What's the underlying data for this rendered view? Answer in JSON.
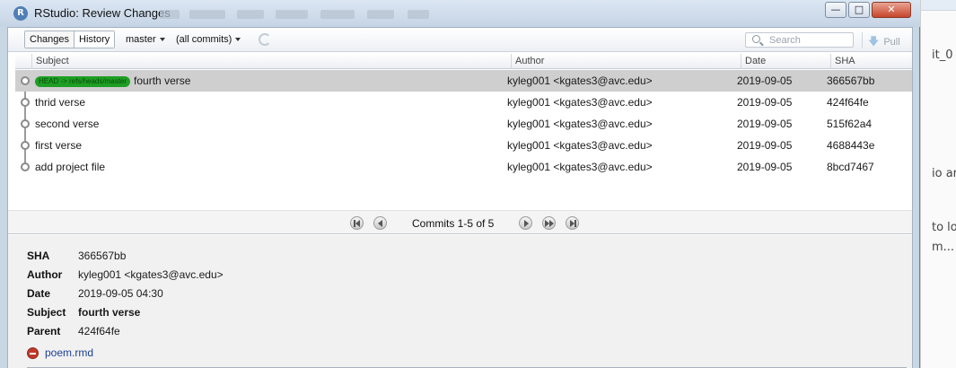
{
  "window": {
    "title": "RStudio: Review Changes",
    "app_icon_letter": "R"
  },
  "toolbar": {
    "tabs": [
      {
        "label": "Changes"
      },
      {
        "label": "History"
      }
    ],
    "branch": "master",
    "filter": "(all commits)",
    "search_placeholder": "Search",
    "pull_label": "Pull"
  },
  "table": {
    "columns": [
      "Subject",
      "Author",
      "Date",
      "SHA"
    ],
    "rows": [
      {
        "subject": "fourth  verse",
        "author": "kyleg001 <kgates3@avc.edu>",
        "date": "2019-09-05",
        "sha": "366567bb",
        "ref_label": "HEAD -> refs/heads/master",
        "selected": true
      },
      {
        "subject": "thrid verse",
        "author": "kyleg001 <kgates3@avc.edu>",
        "date": "2019-09-05",
        "sha": "424f64fe"
      },
      {
        "subject": "second verse",
        "author": "kyleg001 <kgates3@avc.edu>",
        "date": "2019-09-05",
        "sha": "515f62a4"
      },
      {
        "subject": "first verse",
        "author": "kyleg001 <kgates3@avc.edu>",
        "date": "2019-09-05",
        "sha": "4688443e"
      },
      {
        "subject": "add project file",
        "author": "kyleg001 <kgates3@avc.edu>",
        "date": "2019-09-05",
        "sha": "8bcd7467"
      }
    ]
  },
  "pager": {
    "text": "Commits 1-5 of 5"
  },
  "details": {
    "sha_label": "SHA",
    "sha": "366567bb",
    "author_label": "Author",
    "author": "kyleg001 <kgates3@avc.edu>",
    "date_label": "Date",
    "date": "2019-09-05 04:30",
    "subject_label": "Subject",
    "subject": "fourth  verse",
    "parent_label": "Parent",
    "parent": "424f64fe",
    "file": "poem.rmd"
  },
  "background_app": {
    "fragments": [
      "it_0",
      "io ar",
      "to lo",
      "m..."
    ]
  },
  "colors": {
    "selected_row": "#cfcfcf",
    "ref_badge": "#1e9e24",
    "title_bar": "#c5d4e5",
    "link": "#1c3f94"
  }
}
